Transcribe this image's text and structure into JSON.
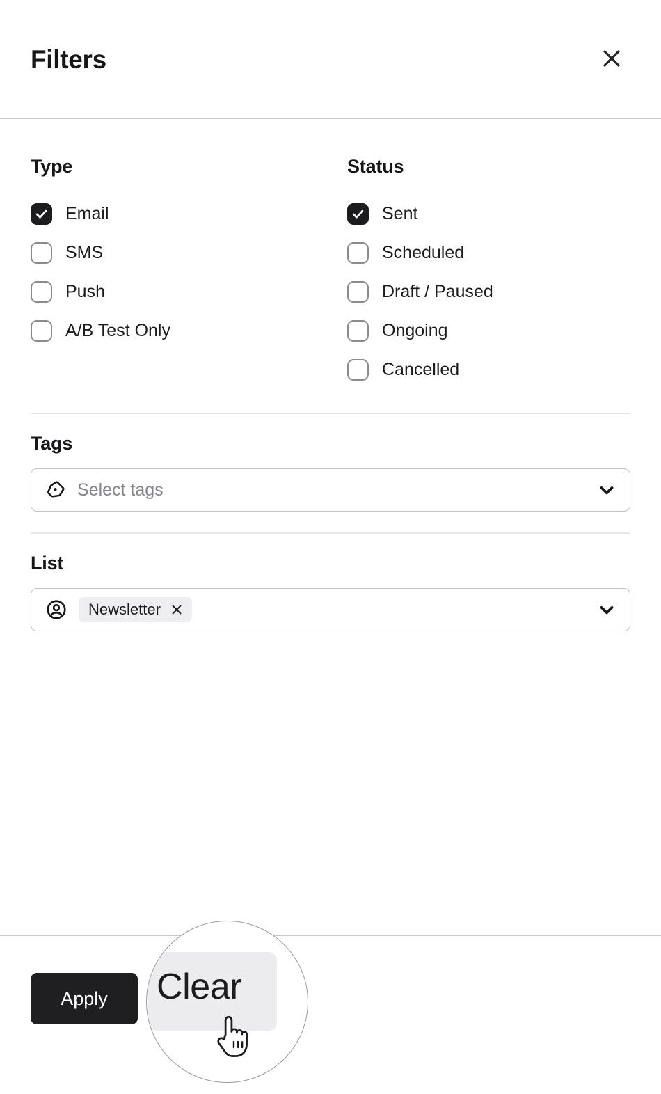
{
  "header": {
    "title": "Filters",
    "close_icon": "close-icon"
  },
  "type_group": {
    "heading": "Type",
    "options": [
      {
        "label": "Email",
        "checked": true
      },
      {
        "label": "SMS",
        "checked": false
      },
      {
        "label": "Push",
        "checked": false
      },
      {
        "label": "A/B Test Only",
        "checked": false
      }
    ]
  },
  "status_group": {
    "heading": "Status",
    "options": [
      {
        "label": "Sent",
        "checked": true
      },
      {
        "label": "Scheduled",
        "checked": false
      },
      {
        "label": "Draft / Paused",
        "checked": false
      },
      {
        "label": "Ongoing",
        "checked": false
      },
      {
        "label": "Cancelled",
        "checked": false
      }
    ]
  },
  "tags_field": {
    "heading": "Tags",
    "placeholder": "Select tags",
    "value": "",
    "icon": "tag-icon",
    "chevron": "chevron-down-icon"
  },
  "list_field": {
    "heading": "List",
    "placeholder": "",
    "icon": "user-circle-icon",
    "chevron": "chevron-down-icon",
    "chips": [
      {
        "label": "Newsletter",
        "remove_icon": "close-icon"
      }
    ]
  },
  "footer": {
    "apply_label": "Apply",
    "clear_label": "Clear"
  },
  "magnifier": {
    "magnified_label": "Clear",
    "cursor": "pointing-hand-cursor"
  },
  "colors": {
    "accent_dark": "#1f1f21",
    "checkbox_border": "#8b8b90",
    "field_border": "#c2c2c6",
    "chip_bg": "#eeeef0",
    "divider": "#e8e8ea",
    "strong_divider": "#c9c9cc",
    "placeholder_text": "#85858b"
  }
}
